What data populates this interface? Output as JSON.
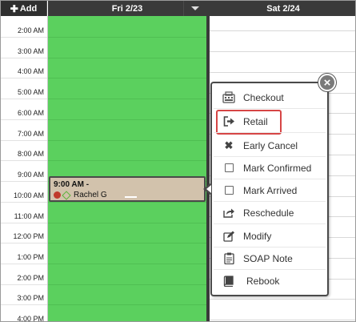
{
  "header": {
    "add_label": "Add",
    "day1": "Fri 2/23",
    "day2": "Sat 2/24"
  },
  "time_slots": [
    "2:00 AM",
    "3:00 AM",
    "4:00 AM",
    "5:00 AM",
    "6:00 AM",
    "7:00 AM",
    "8:00 AM",
    "9:00 AM",
    "10:00 AM",
    "11:00 AM",
    "12:00 PM",
    "1:00 PM",
    "2:00 PM",
    "3:00 PM",
    "4:00 PM"
  ],
  "appointment": {
    "time": "9:00 AM -",
    "client": "Rachel G",
    "status_colors": {
      "dot": "#c0392b",
      "diamond": "#5bb33a"
    }
  },
  "column_colors": {
    "friday": "#5bd05e",
    "appointment": "#d2c2ac",
    "header": "#3a3a3a"
  },
  "menu": {
    "close_glyph": "×",
    "items": [
      {
        "label": "Checkout",
        "icon": "register-icon"
      },
      {
        "label": "Retail",
        "icon": "sign-out-icon",
        "highlighted": true
      },
      {
        "label": "Early Cancel",
        "icon": "x-icon"
      },
      {
        "label": "Mark Confirmed",
        "icon": "checkbox-icon"
      },
      {
        "label": "Mark Arrived",
        "icon": "checkbox-icon"
      },
      {
        "label": "Reschedule",
        "icon": "share-arrow-icon"
      },
      {
        "label": "Modify",
        "icon": "edit-icon"
      },
      {
        "label": "SOAP Note",
        "icon": "clipboard-icon"
      },
      {
        "label": "Rebook",
        "icon": "book-icon"
      }
    ]
  }
}
